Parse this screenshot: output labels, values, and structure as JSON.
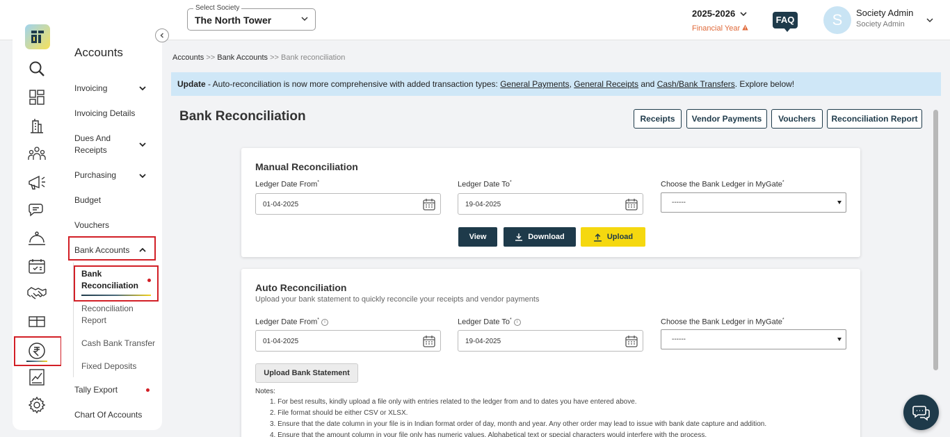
{
  "topbar": {
    "society_label": "Select Society",
    "society_value": "The North Tower",
    "financial_year": "2025-2026",
    "financial_year_label": "Financial Year",
    "faq": "FAQ",
    "avatar_initial": "S",
    "user_name": "Society Admin",
    "user_role": "Society Admin"
  },
  "rail_icons": [
    "logo",
    "search-icon",
    "dashboard-icon",
    "building-icon",
    "people-icon",
    "megaphone-icon",
    "chat-icon",
    "concierge-icon",
    "calendar-icon",
    "handshake-icon",
    "package-icon",
    "rupee-icon",
    "chart-icon",
    "settings-icon"
  ],
  "subnav": {
    "title": "Accounts",
    "items": [
      {
        "label": "Invoicing"
      },
      {
        "label": "Invoicing Details"
      },
      {
        "label": "Dues And Receipts"
      },
      {
        "label": "Purchasing"
      },
      {
        "label": "Budget"
      },
      {
        "label": "Vouchers"
      },
      {
        "label": "Bank Accounts"
      },
      {
        "label": "Tally Export"
      },
      {
        "label": "Chart Of Accounts"
      }
    ],
    "bank_sub": [
      {
        "label": "Bank Reconciliation"
      },
      {
        "label": "Reconciliation Report"
      },
      {
        "label": "Cash Bank Transfer"
      },
      {
        "label": "Fixed Deposits"
      }
    ]
  },
  "breadcrumb": {
    "item1": "Accounts",
    "sep": ">>",
    "item2": "Bank Accounts",
    "item3": "Bank reconciliation"
  },
  "banner": {
    "bold": "Update",
    "text1": " - Auto-reconciliation is now more comprehensive with added transaction types: ",
    "link1": "General Payments",
    "comma": ", ",
    "link2": "General Receipts",
    "and": " and ",
    "link3": "Cash/Bank Transfers",
    "text2": ". Explore below!"
  },
  "page": {
    "title": "Bank Reconciliation",
    "buttons": {
      "receipts": "Receipts",
      "vendor_payments": "Vendor Payments",
      "vouchers": "Vouchers",
      "reconciliation_report": "Reconciliation Report"
    }
  },
  "manual": {
    "title": "Manual Reconciliation",
    "from_label": "Ledger Date From",
    "to_label": "Ledger Date To",
    "ledger_label": "Choose the Bank Ledger in MyGate",
    "required_mark": "*",
    "from_value": "01-04-2025",
    "to_value": "19-04-2025",
    "ledger_value": "------",
    "view": "View",
    "download": "Download",
    "upload": "Upload"
  },
  "auto": {
    "title": "Auto Reconciliation",
    "subtitle": "Upload your bank statement to quickly reconcile your receipts and vendor payments",
    "from_label": "Ledger Date From",
    "to_label": "Ledger Date To",
    "ledger_label": "Choose the Bank Ledger in MyGate",
    "required_mark": "*",
    "from_value": "01-04-2025",
    "to_value": "19-04-2025",
    "ledger_value": "------",
    "upload_statement": "Upload Bank Statement",
    "notes_title": "Notes:",
    "notes": [
      "1. For best results, kindly upload a file only with entries related to the ledger from and to dates you have entered above.",
      "2. File format should be either CSV or XLSX.",
      "3. Ensure that the date column in your file is in Indian format order of day, month and year. Any other order may lead to issue with bank date capture and addition.",
      "4. Ensure that the amount column in your file only has numeric values. Alphabetical text or special characters would interfere with the process."
    ]
  },
  "colors": {
    "brand_dark": "#1e3a4a",
    "accent_yellow": "#f5d80f",
    "banner_bg": "#cfe7f7",
    "highlight_red": "#d21f26"
  }
}
